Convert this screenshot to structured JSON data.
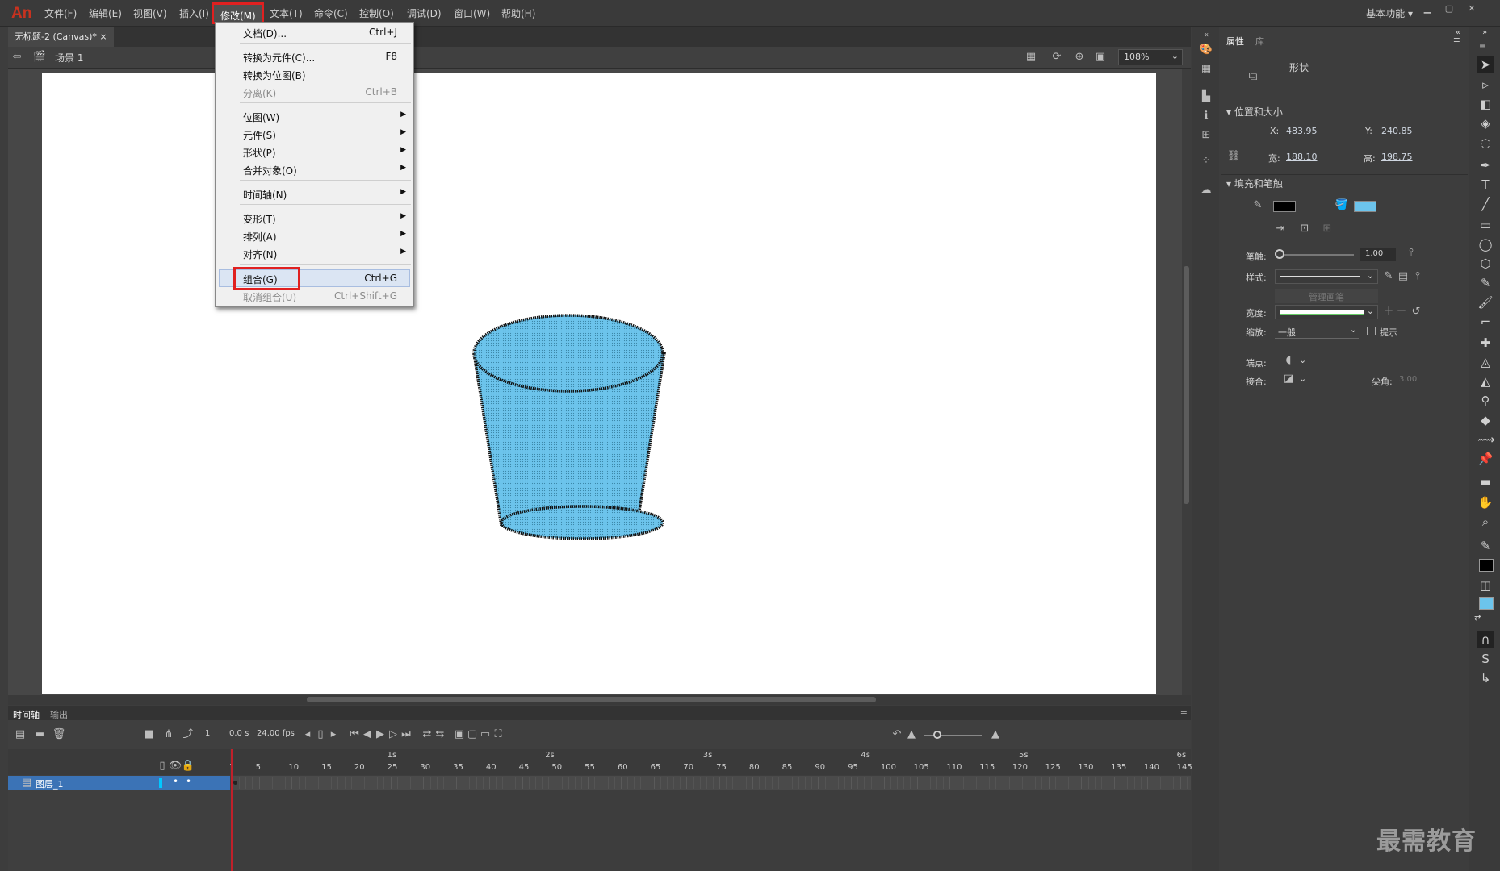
{
  "app": {
    "logo": "An"
  },
  "menubar": {
    "items": [
      "文件(F)",
      "编辑(E)",
      "视图(V)",
      "插入(I)",
      "修改(M)",
      "文本(T)",
      "命令(C)",
      "控制(O)",
      "调试(D)",
      "窗口(W)",
      "帮助(H)"
    ],
    "workspace": "基本功能"
  },
  "doc_tab": {
    "title": "无标题-2 (Canvas)*"
  },
  "edit_bar": {
    "scene": "场景 1",
    "zoom": "108%"
  },
  "modify_menu": {
    "items": [
      {
        "label": "文档(D)...",
        "shortcut": "Ctrl+J",
        "disabled": false
      },
      {
        "label": "转换为元件(C)...",
        "shortcut": "F8",
        "disabled": false
      },
      {
        "label": "转换为位图(B)",
        "shortcut": "",
        "disabled": false
      },
      {
        "label": "分离(K)",
        "shortcut": "Ctrl+B",
        "disabled": true
      },
      {
        "label": "位图(W)",
        "submenu": true
      },
      {
        "label": "元件(S)",
        "submenu": true
      },
      {
        "label": "形状(P)",
        "submenu": true
      },
      {
        "label": "合并对象(O)",
        "submenu": true
      },
      {
        "label": "时间轴(N)",
        "submenu": true
      },
      {
        "label": "变形(T)",
        "submenu": true
      },
      {
        "label": "排列(A)",
        "submenu": true
      },
      {
        "label": "对齐(N)",
        "submenu": true
      },
      {
        "label": "组合(G)",
        "shortcut": "Ctrl+G",
        "disabled": false,
        "highlighted": true
      },
      {
        "label": "取消组合(U)",
        "shortcut": "Ctrl+Shift+G",
        "disabled": true
      }
    ]
  },
  "properties": {
    "tabs": [
      "属性",
      "库"
    ],
    "object_type": "形状",
    "position_size": {
      "header": "位置和大小",
      "x_label": "X:",
      "x": "483.95",
      "y_label": "Y:",
      "y": "240.85",
      "w_label": "宽:",
      "w": "188.10",
      "h_label": "高:",
      "h": "198.75"
    },
    "fill_stroke": {
      "header": "填充和笔触",
      "stroke_color": "#000000",
      "fill_color": "#6cc4ec",
      "stroke_label": "笔触:",
      "stroke_value": "1.00",
      "style_label": "样式:",
      "manage_brush": "管理画笔",
      "width_label": "宽度:",
      "scale_label": "缩放:",
      "scale_value": "一般",
      "hint_label": "提示",
      "cap_label": "端点:",
      "join_label": "接合:",
      "miter_label": "尖角:",
      "miter_value": "3.00"
    }
  },
  "timeline": {
    "tabs": [
      "时间轴",
      "输出"
    ],
    "frame": "1",
    "time": "0.0 s",
    "fps": "24.00 fps",
    "seconds": [
      "1s",
      "2s",
      "3s",
      "4s",
      "5s",
      "6s"
    ],
    "frame_ticks": [
      "1",
      "5",
      "10",
      "15",
      "20",
      "25",
      "30",
      "35",
      "40",
      "45",
      "50",
      "55",
      "60",
      "65",
      "70",
      "75",
      "80",
      "85",
      "90",
      "95",
      "100",
      "105",
      "110",
      "115",
      "120",
      "125",
      "130",
      "135",
      "140",
      "145"
    ],
    "layer_name": "图层_1",
    "layer_color": "#00c8ff"
  },
  "watermark": "最需教育",
  "colors": {
    "accent_red": "#e02020",
    "cup_fill": "#6cc4ec"
  }
}
